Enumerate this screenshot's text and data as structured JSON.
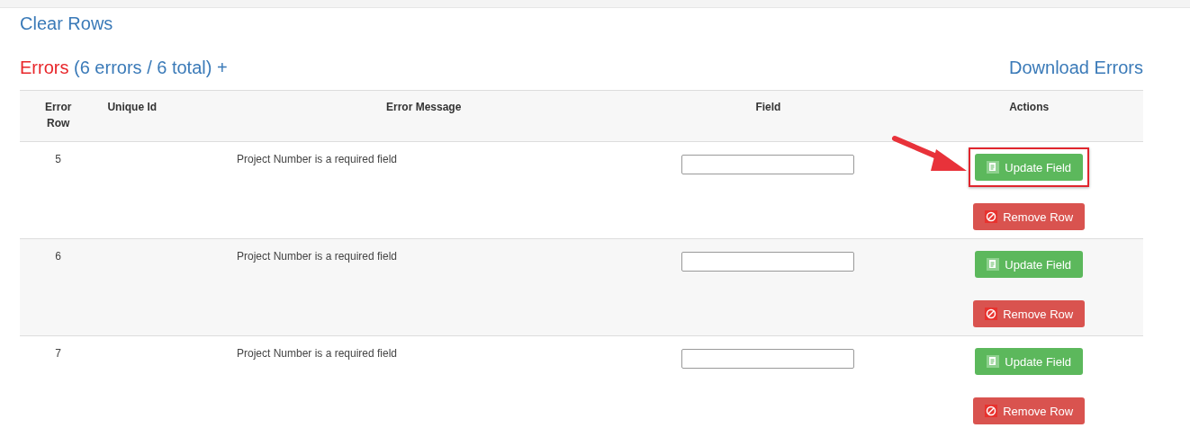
{
  "clear_link": "Clear Rows",
  "errors_heading": {
    "label": "Errors",
    "summary": "(6 errors / 6 total) +"
  },
  "download_link": "Download Errors",
  "table": {
    "columns": [
      "Error\nRow",
      "Unique Id",
      "Error Message",
      "Field",
      "Actions"
    ],
    "rows": [
      {
        "error_row": "5",
        "unique_id": "",
        "message": "Project Number is a required field",
        "update_label": "Update Field",
        "remove_label": "Remove Row",
        "highlighted": true
      },
      {
        "error_row": "6",
        "unique_id": "",
        "message": "Project Number is a required field",
        "update_label": "Update Field",
        "remove_label": "Remove Row",
        "highlighted": false
      },
      {
        "error_row": "7",
        "unique_id": "",
        "message": "Project Number is a required field",
        "update_label": "Update Field",
        "remove_label": "Remove Row",
        "highlighted": false
      }
    ]
  }
}
